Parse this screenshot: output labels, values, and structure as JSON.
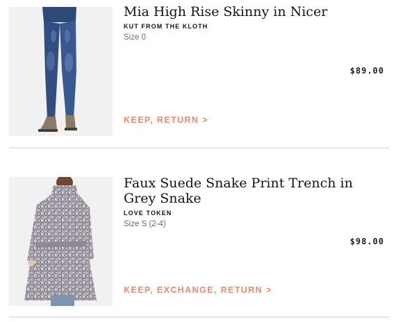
{
  "items": [
    {
      "title": "Mia High Rise Skinny in Nicer",
      "brand": "KUT FROM THE KLOTH",
      "size": "Size 0",
      "price": "$89.00",
      "actions": "KEEP, RETURN >",
      "image": "jeans-product-photo"
    },
    {
      "title": "Faux Suede Snake Print Trench in Grey Snake",
      "brand": "LOVE TOKEN",
      "size": "Size S (2-4)",
      "price": "$98.00",
      "actions": "KEEP, EXCHANGE, RETURN >",
      "image": "trench-coat-product-photo"
    }
  ],
  "colors": {
    "accent": "#f08b6a",
    "divider": "#e6e6e6",
    "muted_text": "#6b6b6b"
  }
}
